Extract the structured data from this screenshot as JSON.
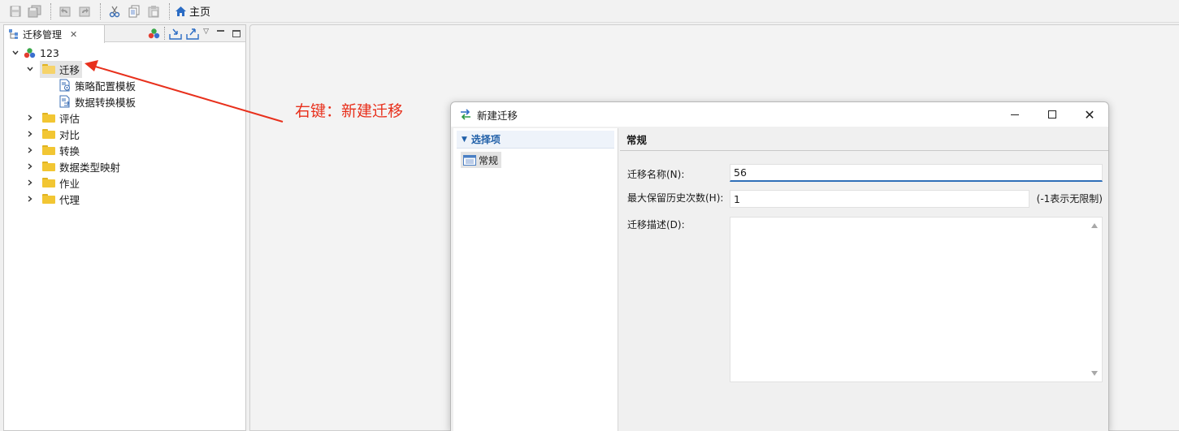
{
  "toolbar": {
    "icons": [
      "save-icon",
      "save-all-icon",
      "undo-icon",
      "redo-icon",
      "cut-icon",
      "copy-icon",
      "paste-icon"
    ],
    "home_label": "主页"
  },
  "left_panel": {
    "tab_title": "迁移管理",
    "tree": {
      "root": "123",
      "migration_folder": "迁移",
      "migration_children": [
        "策略配置模板",
        "数据转换模板"
      ],
      "folders": [
        "评估",
        "对比",
        "转换",
        "数据类型映射",
        "作业",
        "代理"
      ]
    }
  },
  "annotation": {
    "text": "右键：新建迁移",
    "color": "#e8301c"
  },
  "dialog": {
    "title": "新建迁移",
    "nav_section": "选择项",
    "nav_item": "常规",
    "page_title": "常规",
    "fields": {
      "name_label": "迁移名称(N):",
      "name_value": "56",
      "history_label": "最大保留历史次数(H):",
      "history_value": "1",
      "history_hint": "(-1表示无限制)",
      "desc_label": "迁移描述(D):"
    }
  }
}
